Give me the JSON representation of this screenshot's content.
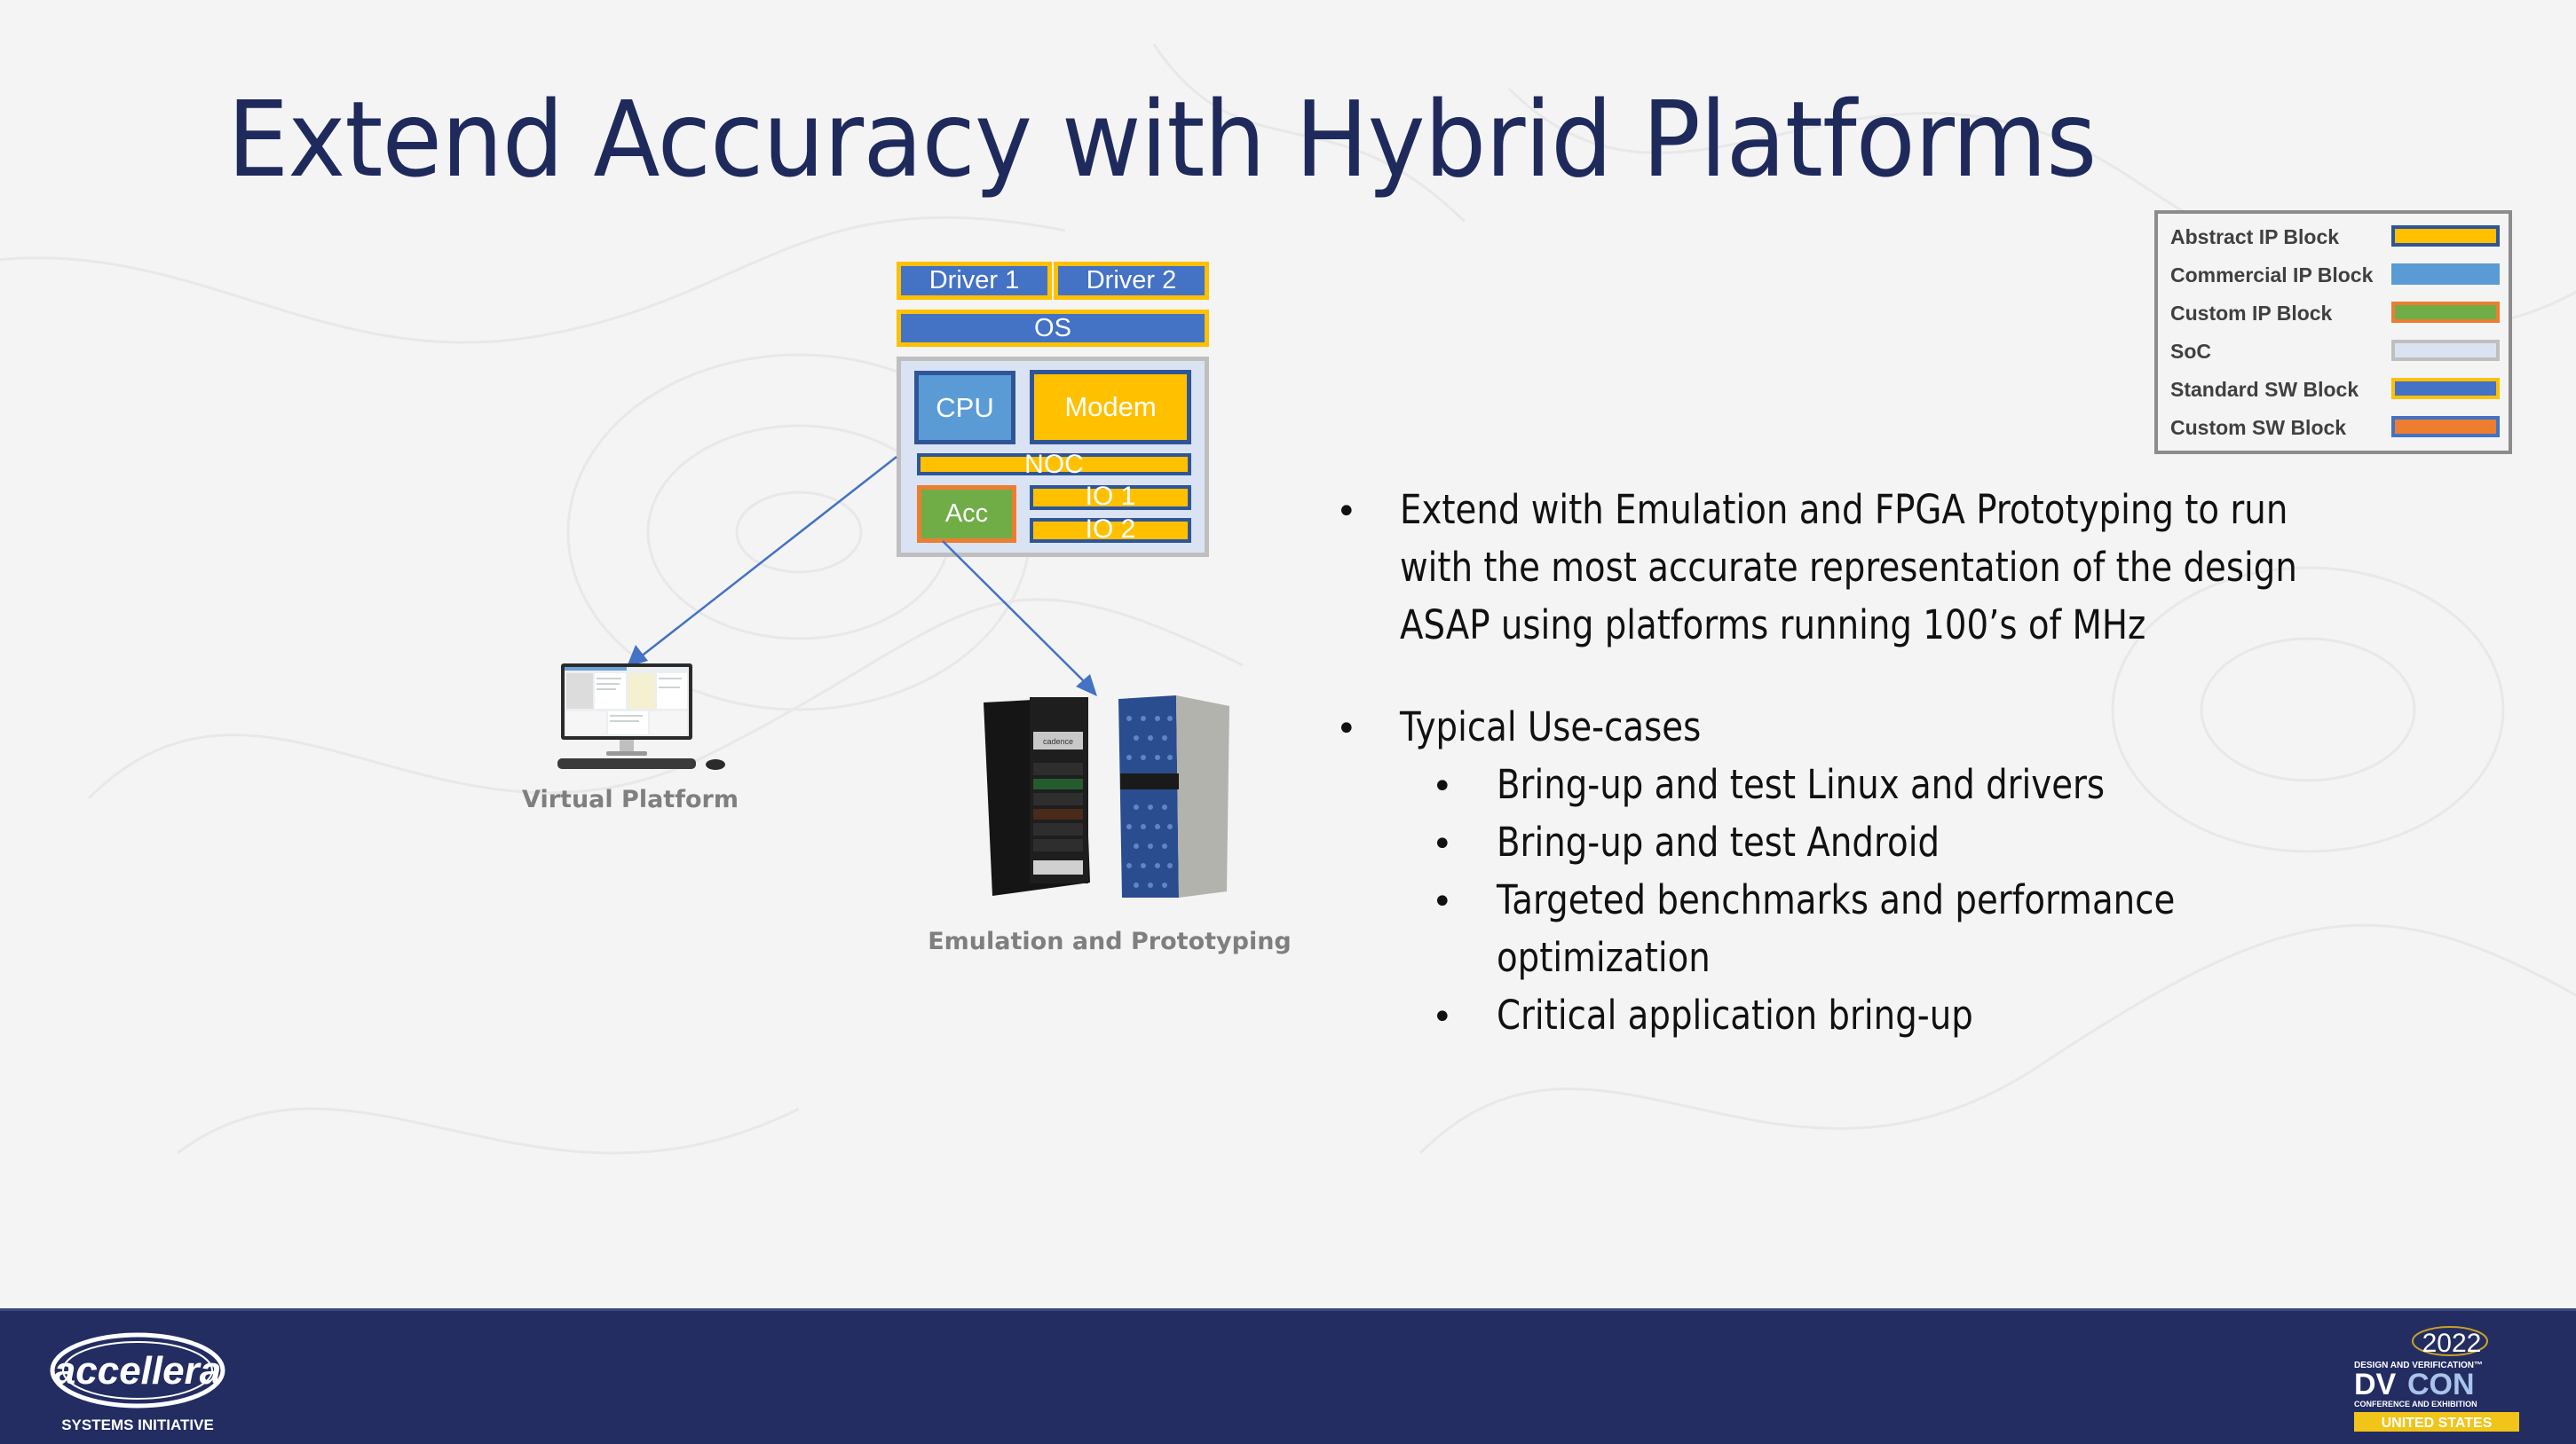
{
  "slide": {
    "title": "Extend Accuracy with Hybrid Platforms"
  },
  "diagram": {
    "sw_blocks": {
      "driver1": "Driver 1",
      "driver2": "Driver 2",
      "os": "OS"
    },
    "soc_blocks": {
      "cpu": "CPU",
      "modem": "Modem",
      "noc": "NOC",
      "acc": "Acc",
      "io1": "IO 1",
      "io2": "IO 2"
    },
    "targets": {
      "virtual_platform": "Virtual Platform",
      "emulation": "Emulation and Prototyping"
    },
    "emulator_brand": "cadence",
    "colors": {
      "standard_sw_fill": "#4472c4",
      "standard_sw_border": "#ffc000",
      "abstract_ip_fill": "#ffc000",
      "abstract_ip_border": "#2f5597",
      "commercial_ip_fill": "#5b9bd5",
      "custom_ip_fill": "#70ad47",
      "custom_ip_border": "#ed7d31",
      "soc_fill": "#dae3f3",
      "soc_border": "#bfbfbf",
      "arrow": "#4472c4"
    }
  },
  "legend": {
    "items": [
      {
        "label": "Abstract IP Block",
        "fill": "#ffc000",
        "border": "#2f5597"
      },
      {
        "label": "Commercial IP Block",
        "fill": "#5b9bd5",
        "border": "#5b9bd5"
      },
      {
        "label": "Custom IP Block",
        "fill": "#70ad47",
        "border": "#ed7d31"
      },
      {
        "label": "SoC",
        "fill": "#dae3f3",
        "border": "#bfbfbf"
      },
      {
        "label": "Standard SW Block",
        "fill": "#4472c4",
        "border": "#ffc000"
      },
      {
        "label": "Custom SW Block",
        "fill": "#ed7d31",
        "border": "#4472c4"
      }
    ]
  },
  "bullets": {
    "main1": {
      "lines": [
        "Extend with Emulation and FPGA Prototyping to run",
        "with the most accurate representation of the design",
        "ASAP using platforms running 100’s of MHz"
      ]
    },
    "main2": {
      "text": "Typical Use-cases",
      "subs": [
        [
          "Bring-up and test Linux and drivers"
        ],
        [
          "Bring-up and test Android"
        ],
        [
          "Targeted benchmarks and performance",
          "optimization"
        ],
        [
          "Critical application bring-up"
        ]
      ]
    },
    "bullet_char": "•"
  },
  "footer": {
    "left_logo": {
      "name": "accellera",
      "subtitle": "SYSTEMS INITIATIVE"
    },
    "right_logo": {
      "year": "2022",
      "top_line": "DESIGN AND VERIFICATION™",
      "brand_dv": "DV",
      "brand_con": "CON",
      "sub_line": "CONFERENCE AND EXHIBITION",
      "region": "UNITED STATES"
    },
    "colors": {
      "band": "#232d62",
      "region_badge": "#f0c419"
    }
  }
}
